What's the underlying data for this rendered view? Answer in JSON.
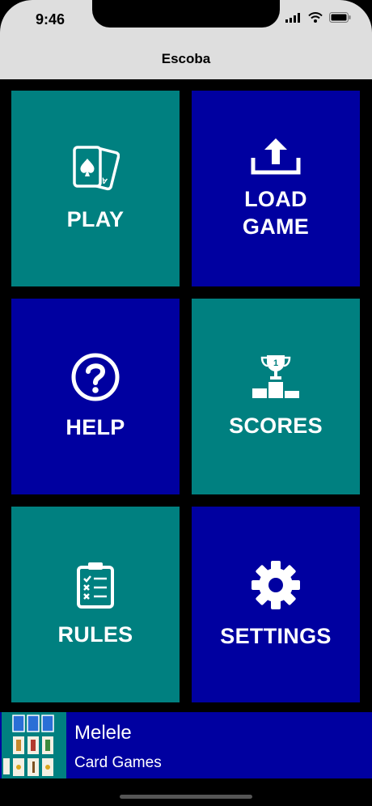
{
  "status": {
    "time": "9:46",
    "icons": [
      "signal-icon",
      "wifi-icon",
      "battery-icon"
    ]
  },
  "nav": {
    "title": "Escoba"
  },
  "menu": {
    "play": {
      "label": "PLAY",
      "icon": "playing-cards-icon"
    },
    "load_game": {
      "label_line1": "LOAD",
      "label_line2": "GAME",
      "icon": "upload-icon"
    },
    "help": {
      "label": "HELP",
      "icon": "question-circle-icon"
    },
    "scores": {
      "label": "SCORES",
      "icon": "trophy-podium-icon"
    },
    "rules": {
      "label": "RULES",
      "icon": "clipboard-checklist-icon"
    },
    "settings": {
      "label": "SETTINGS",
      "icon": "gear-icon"
    }
  },
  "ad": {
    "title": "Melele",
    "subtitle": "Card Games",
    "icon": "card-games-thumbnail"
  },
  "colors": {
    "teal": "#008080",
    "navy": "#0000a0",
    "background": "#000000",
    "header": "#dedede"
  }
}
